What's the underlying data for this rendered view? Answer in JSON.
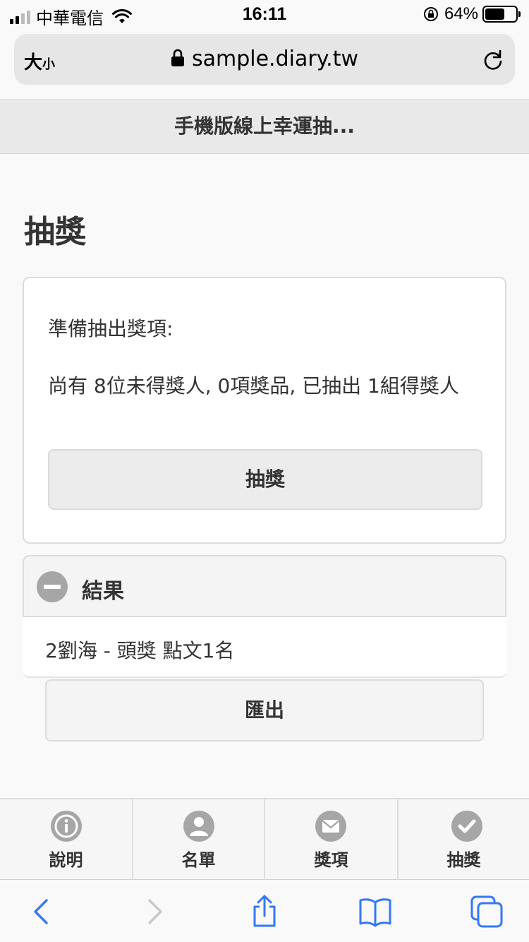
{
  "status_bar": {
    "carrier": "中華電信",
    "time": "16:11",
    "battery": "64%",
    "battery_level": 0.64
  },
  "browser": {
    "text_size_label": "大",
    "text_size_small": "小",
    "url": "sample.diary.tw"
  },
  "header": {
    "title": "手機版線上幸運抽..."
  },
  "page": {
    "title": "抽獎"
  },
  "draw_card": {
    "prompt": "準備抽出獎項:",
    "summary": "尚有 8位未得獎人, 0項獎品, 已抽出 1組得獎人",
    "button_label": "抽獎"
  },
  "results": {
    "title": "結果",
    "items": [
      "2劉海 - 頭獎 點文1名"
    ]
  },
  "export_button_label": "匯出",
  "tabs": [
    {
      "label": "說明",
      "icon": "info-icon"
    },
    {
      "label": "名單",
      "icon": "person-icon"
    },
    {
      "label": "獎項",
      "icon": "mail-icon"
    },
    {
      "label": "抽獎",
      "icon": "check-icon"
    }
  ],
  "colors": {
    "accent": "#3478f6",
    "icon_gray": "#a6a6a6",
    "disabled": "#c7c7cc"
  }
}
